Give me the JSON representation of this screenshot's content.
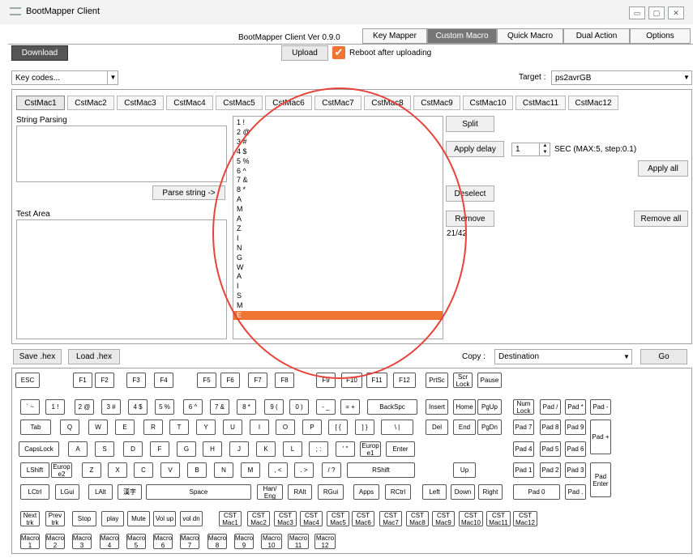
{
  "window": {
    "title": "BootMapper Client",
    "minimize": "▭",
    "restore": "▢",
    "close": "✕"
  },
  "version": "BootMapper Client Ver 0.9.0",
  "tabs": [
    "Key Mapper",
    "Custom Macro",
    "Quick Macro",
    "Dual Action",
    "Options"
  ],
  "active_tab": "Custom Macro",
  "toolbar": {
    "download": "Download",
    "upload": "Upload",
    "reboot_label": "Reboot after uploading",
    "reboot_checked": true
  },
  "keycodes": {
    "value": "Key codes..."
  },
  "target": {
    "label": "Target :",
    "value": "ps2avrGB"
  },
  "macro_tabs": [
    "CstMac1",
    "CstMac2",
    "CstMac3",
    "CstMac4",
    "CstMac5",
    "CstMac6",
    "CstMac7",
    "CstMac8",
    "CstMac9",
    "CstMac10",
    "CstMac11",
    "CstMac12"
  ],
  "left": {
    "string_parsing": "String Parsing",
    "parse_button": "Parse string ->",
    "test_area": "Test Area"
  },
  "list_items": [
    "1 !",
    "2 @",
    "3 #",
    "4 $",
    "5 %",
    "6 ^",
    "7 &",
    "8 *",
    "A",
    "M",
    "A",
    "Z",
    "I",
    "N",
    "G",
    "W",
    "A",
    "I",
    "S",
    "M",
    "E"
  ],
  "selected_index": 20,
  "right": {
    "split": "Split",
    "apply_delay": "Apply delay",
    "delay_value": "1",
    "delay_hint": "SEC (MAX:5, step:0.1)",
    "apply_all": "Apply all",
    "deselect": "Deselect",
    "remove": "Remove",
    "remove_all": "Remove all",
    "count": "21/42"
  },
  "bottom": {
    "save_hex": "Save .hex",
    "load_hex": "Load .hex",
    "copy_label": "Copy :",
    "copy_value": "Destination",
    "go": "Go"
  },
  "keys": {
    "esc": "ESC",
    "f1": "F1",
    "f2": "F2",
    "f3": "F3",
    "f4": "F4",
    "f5": "F5",
    "f6": "F6",
    "f7": "F7",
    "f8": "F8",
    "f9": "F9",
    "f10": "F10",
    "f11": "F11",
    "f12": "F12",
    "prtsc": "PrtSc",
    "scrlock": "Scr Lock",
    "pause": "Pause",
    "grave": "` ~",
    "k1": "1 !",
    "k2": "2 @",
    "k3": "3 #",
    "k4": "4 $",
    "k5": "5 %",
    "k6": "6 ^",
    "k7": "7 &",
    "k8": "8 *",
    "k9": "9 (",
    "k0": "0 )",
    "minus": "- _",
    "equal": "= +",
    "backspace": "BackSpc",
    "insert": "Insert",
    "home": "Home",
    "pgup": "PgUp",
    "numlock": "Num Lock",
    "pad_slash": "Pad /",
    "pad_star": "Pad *",
    "pad_minus": "Pad -",
    "tab": "Tab",
    "q": "Q",
    "w": "W",
    "e": "E",
    "r": "R",
    "t": "T",
    "y": "Y",
    "u": "U",
    "i": "I",
    "o": "O",
    "p": "P",
    "lbracket": "[ {",
    "rbracket": "] }",
    "backslash": "\\ |",
    "del": "Del",
    "end": "End",
    "pgdn": "PgDn",
    "pad7": "Pad 7",
    "pad8": "Pad 8",
    "pad9": "Pad 9",
    "pad_plus": "Pad +",
    "caps": "CapsLock",
    "a": "A",
    "s": "S",
    "d": "D",
    "f": "F",
    "g": "G",
    "h": "H",
    "j": "J",
    "k": "K",
    "l": "L",
    "semicolon": "; :",
    "quote": "' \"",
    "europe1": "Europ e1",
    "enter": "Enter",
    "pad4": "Pad 4",
    "pad5": "Pad 5",
    "pad6": "Pad 6",
    "lshift": "LShift",
    "europe2": "Europ e2",
    "z": "Z",
    "x": "X",
    "c": "C",
    "v": "V",
    "b": "B",
    "n": "N",
    "m": "M",
    "comma": ", <",
    "period": ". >",
    "slash": "/ ?",
    "rshift": "RShift",
    "up": "Up",
    "pad1": "Pad 1",
    "pad2": "Pad 2",
    "pad3": "Pad 3",
    "pad_enter": "Pad Enter",
    "lctrl": "LCtrl",
    "lgui": "LGui",
    "lalt": "LAlt",
    "hanja": "漢字",
    "space": "Space",
    "haneng": "Han/ Eng",
    "ralt": "RAlt",
    "rgui": "RGui",
    "apps": "Apps",
    "rctrl": "RCtrl",
    "left": "Left",
    "down": "Down",
    "right": "Right",
    "pad0": "Pad 0",
    "pad_dot": "Pad .",
    "nexttrk": "Next trk",
    "prevtrk": "Prev trk",
    "stop": "Stop",
    "play": "play",
    "mute": "Mute",
    "volup": "Vol up",
    "voldn": "vol dn",
    "cst1": "CST Mac1",
    "cst2": "CST Mac2",
    "cst3": "CST Mac3",
    "cst4": "CST Mac4",
    "cst5": "CST Mac5",
    "cst6": "CST Mac6",
    "cst7": "CST Mac7",
    "cst8": "CST Mac8",
    "cst9": "CST Mac9",
    "cst10": "CST Mac10",
    "cst11": "CST Mac11",
    "cst12": "CST Mac12",
    "m1": "Macro 1",
    "m2": "Macro 2",
    "m3": "Macro 3",
    "m4": "Macro 4",
    "m5": "Macro 5",
    "m6": "Macro 6",
    "m7": "Macro 7",
    "m8": "Macro 8",
    "m9": "Macro 9",
    "m10": "Macro 10",
    "m11": "Macro 11",
    "m12": "Macro 12"
  },
  "colors": {
    "accent_orange": "#f07432",
    "annotation_red": "#e8433a",
    "active_tab": "#777777"
  }
}
